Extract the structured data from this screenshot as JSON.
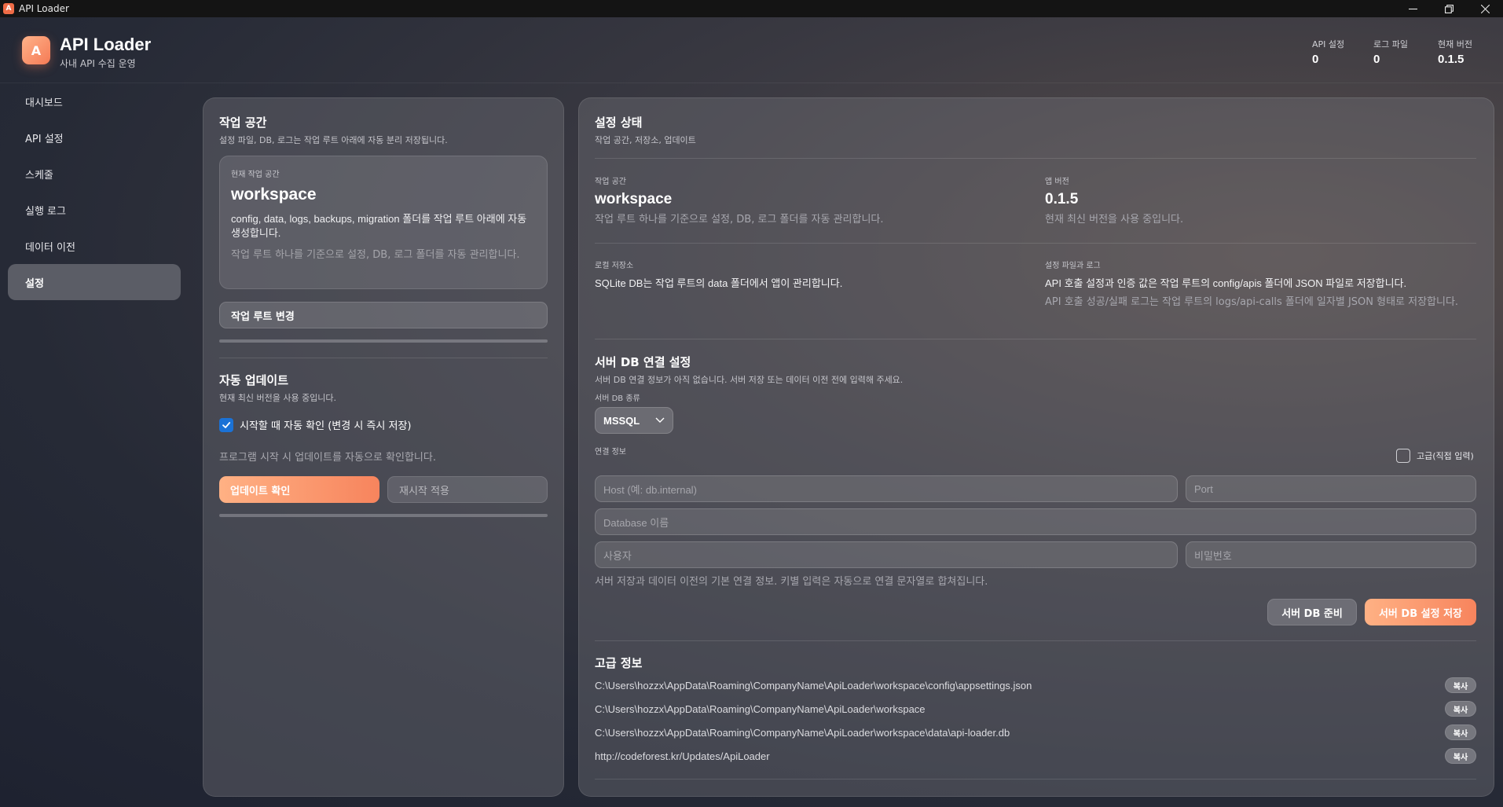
{
  "window": {
    "title": "API Loader",
    "icon_letter": "A"
  },
  "header": {
    "logo_letter": "A",
    "app_name": "API Loader",
    "app_subtitle": "사내 API 수집 운영",
    "stats": [
      {
        "label": "API 설정",
        "value": "0"
      },
      {
        "label": "로그 파일",
        "value": "0"
      },
      {
        "label": "현재 버전",
        "value": "0.1.5"
      }
    ]
  },
  "sidebar": {
    "items": [
      {
        "label": "대시보드",
        "active": false
      },
      {
        "label": "API 설정",
        "active": false
      },
      {
        "label": "스케줄",
        "active": false
      },
      {
        "label": "실행 로그",
        "active": false
      },
      {
        "label": "데이터 이전",
        "active": false
      },
      {
        "label": "설정",
        "active": true
      }
    ]
  },
  "workspace": {
    "title": "작업 공간",
    "subtitle": "설정 파일, DB, 로그는 작업 루트 아래에 자동 분리 저장됩니다.",
    "card_caption": "현재 작업 공간",
    "card_name": "workspace",
    "card_desc": "config, data, logs, backups, migration 폴더를 작업 루트 아래에 자동 생성합니다.",
    "card_desc2": "작업 루트 하나를 기준으로 설정, DB, 로그 폴더를 자동 관리합니다.",
    "change_button": "작업 루트 변경"
  },
  "update": {
    "title": "자동 업데이트",
    "subtitle": "현재 최신 버전을 사용 중입니다.",
    "checkbox_label": "시작할 때 자동 확인 (변경 시 즉시 저장)",
    "checkbox_checked": true,
    "hint": "프로그램 시작 시 업데이트를 자동으로 확인합니다.",
    "check_button": "업데이트 확인",
    "restart_button": "재시작 적용"
  },
  "status": {
    "title": "설정 상태",
    "subtitle": "작업 공간, 저장소, 업데이트",
    "workspace_label": "작업 공간",
    "workspace_value": "workspace",
    "workspace_desc": "작업 루트 하나를 기준으로 설정, DB, 로그 폴더를 자동 관리합니다.",
    "version_label": "앱 버전",
    "version_value": "0.1.5",
    "version_desc": "현재 최신 버전을 사용 중입니다.",
    "local_label": "로컬 저장소",
    "local_text": "SQLite DB는 작업 루트의 data 폴더에서 앱이 관리합니다.",
    "files_label": "설정 파일과 로그",
    "files_text": "API 호출 설정과 인증 값은 작업 루트의 config/apis 폴더에 JSON 파일로 저장합니다.",
    "files_desc": "API 호출 성공/실패 로그는 작업 루트의 logs/api-calls 폴더에 일자별 JSON 형태로 저장합니다."
  },
  "serverdb": {
    "title": "서버 DB 연결 설정",
    "subtitle": "서버 DB 연결 정보가 아직 없습니다. 서버 저장 또는 데이터 이전 전에 입력해 주세요.",
    "type_label": "서버 DB 종류",
    "type_value": "MSSQL",
    "conn_label": "연결 정보",
    "advanced_label": "고급(직접 입력)",
    "advanced_checked": false,
    "host_placeholder": "Host (예: db.internal)",
    "port_placeholder": "Port",
    "database_placeholder": "Database 이름",
    "user_placeholder": "사용자",
    "password_placeholder": "비밀번호",
    "note": "서버 저장과 데이터 이전의 기본 연결 정보. 키별 입력은 자동으로 연결 문자열로 합쳐집니다.",
    "prepare_button": "서버 DB 준비",
    "save_button": "서버 DB 설정 저장"
  },
  "advanced": {
    "title": "고급 정보",
    "copy_label": "복사",
    "paths": [
      "C:\\Users\\hozzx\\AppData\\Roaming\\CompanyName\\ApiLoader\\workspace\\config\\appsettings.json",
      "C:\\Users\\hozzx\\AppData\\Roaming\\CompanyName\\ApiLoader\\workspace",
      "C:\\Users\\hozzx\\AppData\\Roaming\\CompanyName\\ApiLoader\\workspace\\data\\api-loader.db",
      "http://codeforest.kr/Updates/ApiLoader"
    ]
  },
  "colors": {
    "accent_orange": "#f7845d",
    "checkbox_blue": "#1b72d6",
    "active_nav": "#5b5d66"
  }
}
